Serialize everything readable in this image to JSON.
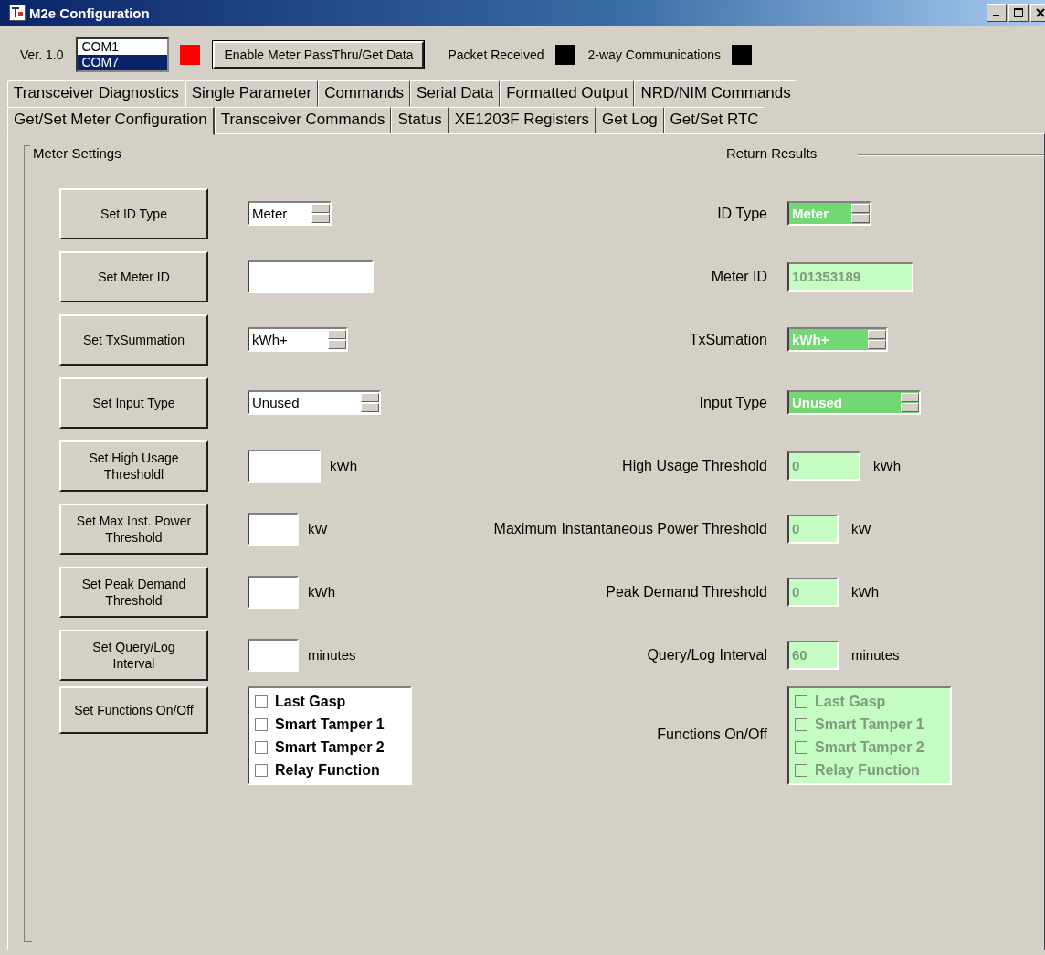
{
  "window": {
    "title": "M2e Configuration"
  },
  "toolbar": {
    "version": "Ver. 1.0",
    "ports": [
      {
        "label": "COM1",
        "selected": false
      },
      {
        "label": "COM7",
        "selected": true
      }
    ],
    "port_status": {
      "color": "#ff0000"
    },
    "pass_thru_button": "Enable Meter PassThru/Get Data",
    "indicators": [
      {
        "label": "Packet Received",
        "color": "#000000"
      },
      {
        "label": "2-way Communications",
        "color": "#000000"
      }
    ]
  },
  "tab_rows": [
    [
      {
        "label": "Transceiver Diagnostics",
        "selected": false
      },
      {
        "label": "Single Parameter",
        "selected": false
      },
      {
        "label": "Commands",
        "selected": false
      },
      {
        "label": "Serial Data",
        "selected": false
      },
      {
        "label": "Formatted Output",
        "selected": false
      },
      {
        "label": "NRD/NIM Commands",
        "selected": false
      }
    ],
    [
      {
        "label": "Get/Set Meter Configuration",
        "selected": true
      },
      {
        "label": "Transceiver Commands",
        "selected": false
      },
      {
        "label": "Status",
        "selected": false
      },
      {
        "label": "XE1203F Registers",
        "selected": false
      },
      {
        "label": "Get Log",
        "selected": false
      },
      {
        "label": "Get/Set RTC",
        "selected": false
      }
    ]
  ],
  "meter_settings_title": "Meter Settings",
  "return_results_title": "Return Results",
  "rows": [
    {
      "button": "Set ID Type",
      "input": {
        "kind": "spinner",
        "value": "Meter"
      },
      "result": {
        "label": "ID Type",
        "kind": "spinner",
        "value": "Meter"
      }
    },
    {
      "button": "Set Meter ID",
      "input": {
        "kind": "text"
      },
      "result": {
        "label": "Meter ID",
        "kind": "text",
        "value": "101353189"
      }
    },
    {
      "button": "Set TxSummation",
      "input": {
        "kind": "spinner",
        "value": "kWh+"
      },
      "result": {
        "label": "TxSumation",
        "kind": "spinner",
        "value": "kWh+"
      }
    },
    {
      "button": "Set Input Type",
      "input": {
        "kind": "spinner",
        "value": "Unused"
      },
      "result": {
        "label": "Input Type",
        "kind": "spinner",
        "value": "Unused"
      }
    },
    {
      "button": "Set High Usage Thresholdl",
      "input": {
        "kind": "text",
        "unit": "kWh"
      },
      "result": {
        "label": "High Usage Threshold",
        "kind": "text",
        "value": "0",
        "unit": "kWh"
      }
    },
    {
      "button": "Set Max Inst. Power Threshold",
      "input": {
        "kind": "text",
        "unit": "kW"
      },
      "result": {
        "label": "Maximum Instantaneous Power Threshold",
        "kind": "text",
        "value": "0",
        "unit": "kW"
      }
    },
    {
      "button": "Set Peak Demand Threshold",
      "input": {
        "kind": "text",
        "unit": "kWh"
      },
      "result": {
        "label": "Peak Demand Threshold",
        "kind": "text",
        "value": "0",
        "unit": "kWh"
      }
    },
    {
      "button": "Set Query/Log Interval",
      "input": {
        "kind": "text",
        "unit": "minutes"
      },
      "result": {
        "label": "Query/Log Interval",
        "kind": "text",
        "value": "60",
        "unit": "minutes"
      }
    },
    {
      "button": "Set Functions On/Off",
      "input": {
        "kind": "checklist",
        "items": [
          {
            "label": "Last Gasp",
            "checked": false
          },
          {
            "label": "Smart Tamper 1",
            "checked": false
          },
          {
            "label": "Smart Tamper 2",
            "checked": false
          },
          {
            "label": "Relay Function",
            "checked": false
          }
        ]
      },
      "result": {
        "label": "Functions On/Off",
        "kind": "checklist",
        "items": [
          {
            "label": "Last Gasp",
            "checked": false
          },
          {
            "label": "Smart Tamper 1",
            "checked": false
          },
          {
            "label": "Smart Tamper 2",
            "checked": false
          },
          {
            "label": "Relay Function",
            "checked": false
          }
        ]
      }
    }
  ]
}
